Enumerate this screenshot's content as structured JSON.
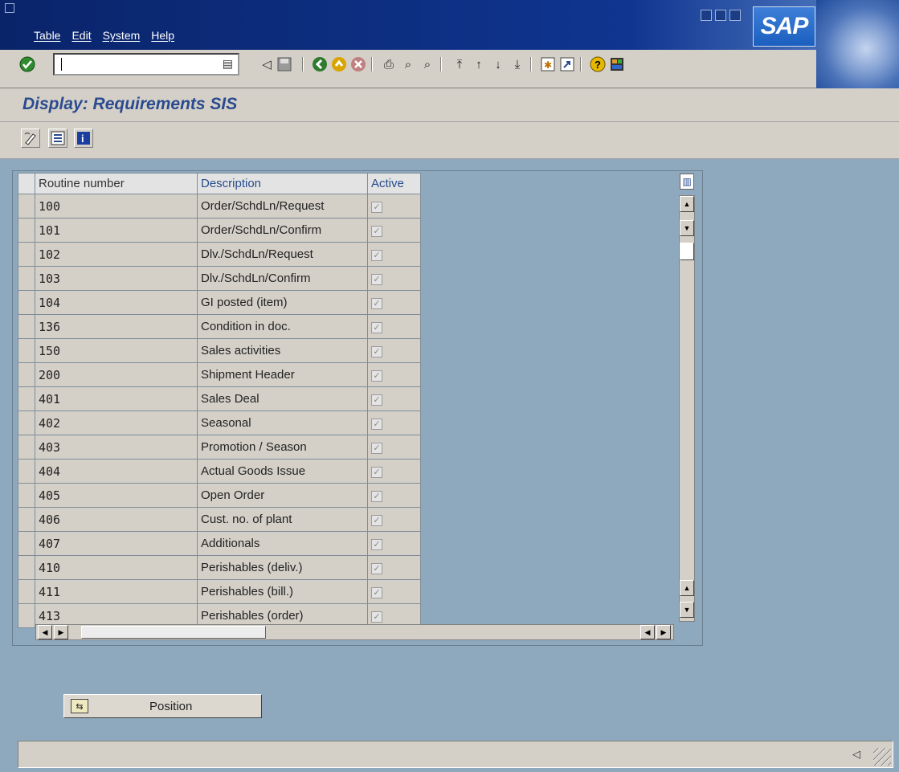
{
  "menu": {
    "items": [
      "Table",
      "Edit",
      "System",
      "Help"
    ]
  },
  "branding": {
    "logo_text": "SAP"
  },
  "toolbar": {
    "command_field_value": ""
  },
  "page": {
    "title": "Display: Requirements SIS"
  },
  "table": {
    "columns": [
      "Routine number",
      "Description",
      "Active"
    ],
    "rows": [
      {
        "number": "100",
        "description": "Order/SchdLn/Request",
        "active": true
      },
      {
        "number": "101",
        "description": "Order/SchdLn/Confirm",
        "active": true
      },
      {
        "number": "102",
        "description": "Dlv./SchdLn/Request",
        "active": true
      },
      {
        "number": "103",
        "description": "Dlv./SchdLn/Confirm",
        "active": true
      },
      {
        "number": "104",
        "description": "GI posted (item)",
        "active": true
      },
      {
        "number": "136",
        "description": "Condition in doc.",
        "active": true
      },
      {
        "number": "150",
        "description": "Sales activities",
        "active": true
      },
      {
        "number": "200",
        "description": "Shipment Header",
        "active": true
      },
      {
        "number": "401",
        "description": "Sales Deal",
        "active": true
      },
      {
        "number": "402",
        "description": "Seasonal",
        "active": true
      },
      {
        "number": "403",
        "description": "Promotion / Season",
        "active": true
      },
      {
        "number": "404",
        "description": "Actual Goods Issue",
        "active": true
      },
      {
        "number": "405",
        "description": "Open Order",
        "active": true
      },
      {
        "number": "406",
        "description": "Cust. no. of plant",
        "active": true
      },
      {
        "number": "407",
        "description": "Additionals",
        "active": true
      },
      {
        "number": "410",
        "description": "Perishables (deliv.)",
        "active": true
      },
      {
        "number": "411",
        "description": "Perishables (bill.)",
        "active": true
      },
      {
        "number": "413",
        "description": "Perishables (order)",
        "active": true
      }
    ]
  },
  "buttons": {
    "position_label": "Position"
  },
  "colors": {
    "title_bar": "#0a246a",
    "page_title": "#2a4b8f",
    "work_area": "#8ea9bd",
    "chrome": "#d4d0c8"
  }
}
